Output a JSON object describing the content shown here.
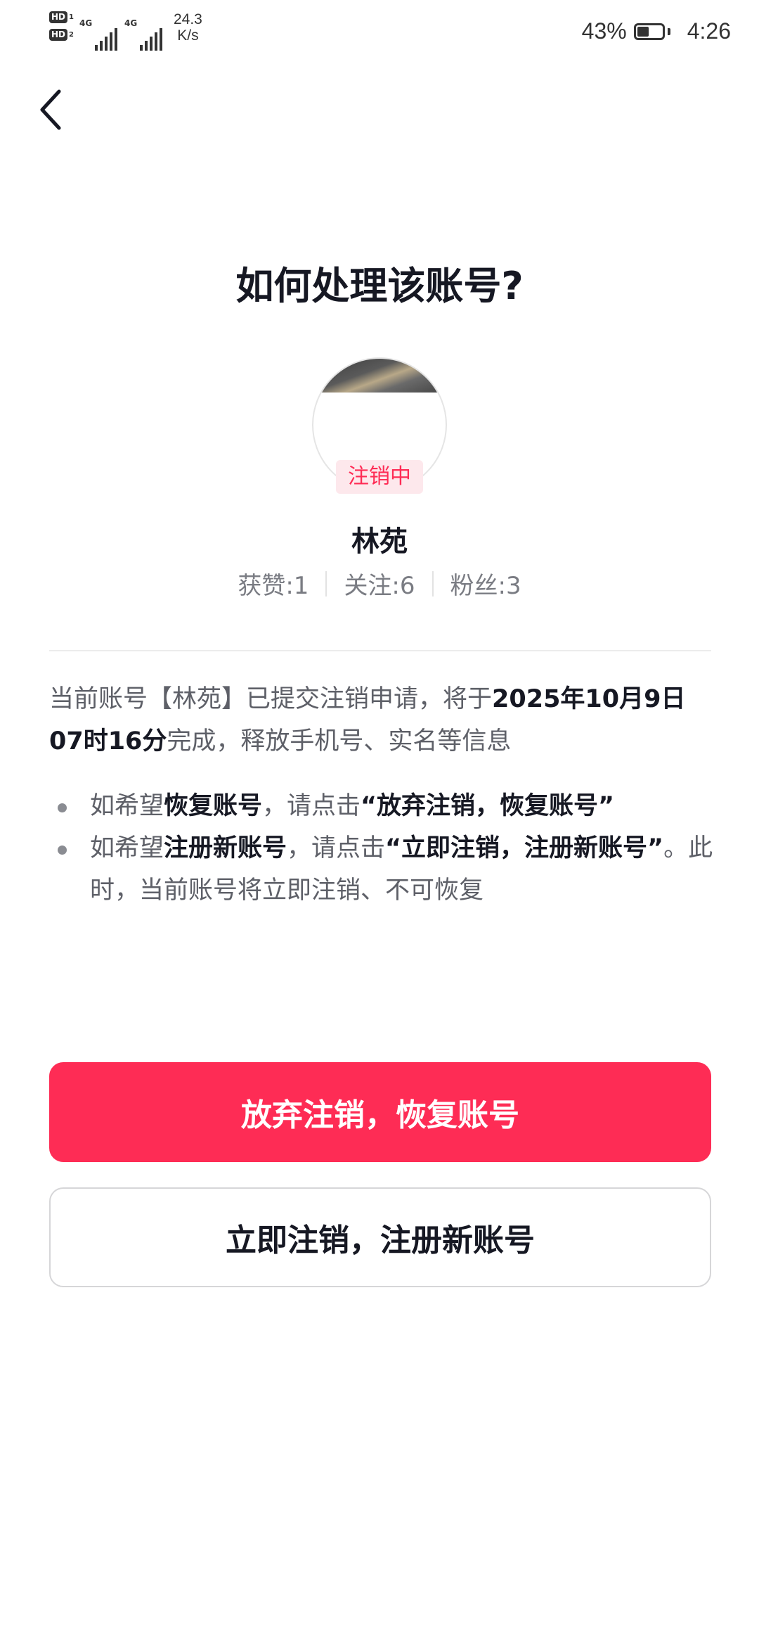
{
  "status_bar": {
    "hd1": "HD",
    "hd1_num": "1",
    "hd2": "HD",
    "hd2_num": "2",
    "net1": "4G",
    "net2": "4G",
    "speed_value": "24.3",
    "speed_unit": "K/s",
    "battery": "43%",
    "time": "4:26"
  },
  "header": {
    "title": "如何处理该账号?"
  },
  "profile": {
    "status_badge": "注销中",
    "name": "林苑",
    "stats": [
      {
        "label": "获赞:",
        "value": "1"
      },
      {
        "label": "关注:",
        "value": "6"
      },
      {
        "label": "粉丝:",
        "value": "3"
      }
    ]
  },
  "notice": {
    "part1": "当前账号【林苑】已提交注销申请，将于",
    "date": "2025年10月9日07时16分",
    "part2": "完成，释放手机号、实名等信息"
  },
  "bullets": [
    {
      "pre": "如希望",
      "bold": "恢复账号",
      "mid": "，请点击",
      "bold2": "“放弃注销，恢复账号”",
      "post": ""
    },
    {
      "pre": "如希望",
      "bold": "注册新账号",
      "mid": "，请点击",
      "bold2": "“立即注销，注册新账号”",
      "post": "。此时，当前账号将立即注销、不可恢复"
    }
  ],
  "buttons": {
    "primary": "放弃注销，恢复账号",
    "secondary": "立即注销，注册新账号"
  },
  "colors": {
    "accent": "#fe2c55",
    "badge_bg": "#fde8ec",
    "text_primary": "#161823",
    "text_secondary": "#5e6068"
  },
  "icons": [
    "back-arrow-icon",
    "signal-icon",
    "battery-icon"
  ]
}
